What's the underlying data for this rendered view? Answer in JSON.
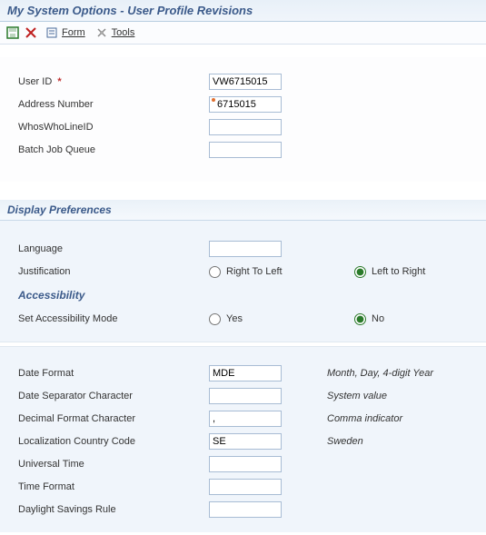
{
  "window": {
    "title": "My System Options - User Profile Revisions"
  },
  "toolbar": {
    "form_label": "Form",
    "tools_label": "Tools"
  },
  "user": {
    "labels": {
      "user_id": "User ID",
      "address_number": "Address Number",
      "whoswho": "WhosWhoLineID",
      "batch_queue": "Batch Job Queue"
    },
    "values": {
      "user_id": "VW6715015",
      "address_number": "6715015",
      "whoswho": "",
      "batch_queue": ""
    }
  },
  "sections": {
    "display_prefs": "Display Preferences",
    "accessibility": "Accessibility"
  },
  "display": {
    "labels": {
      "language": "Language",
      "justification": "Justification",
      "rtl": "Right To Left",
      "ltr": "Left to Right",
      "set_access": "Set Accessibility Mode",
      "yes": "Yes",
      "no": "No",
      "date_format": "Date Format",
      "date_sep": "Date Separator Character",
      "decimal_fmt": "Decimal Format Character",
      "loc_country": "Localization Country Code",
      "universal_time": "Universal Time",
      "time_format": "Time Format",
      "dst_rule": "Daylight Savings Rule"
    },
    "values": {
      "language": "",
      "date_format": "MDE",
      "date_sep": "",
      "decimal_fmt": ",",
      "loc_country": "SE",
      "universal_time": "",
      "time_format": "",
      "dst_rule": ""
    },
    "descs": {
      "date_format": "Month, Day, 4-digit Year",
      "date_sep": "System value",
      "decimal_fmt": "Comma indicator",
      "loc_country": "Sweden"
    }
  }
}
